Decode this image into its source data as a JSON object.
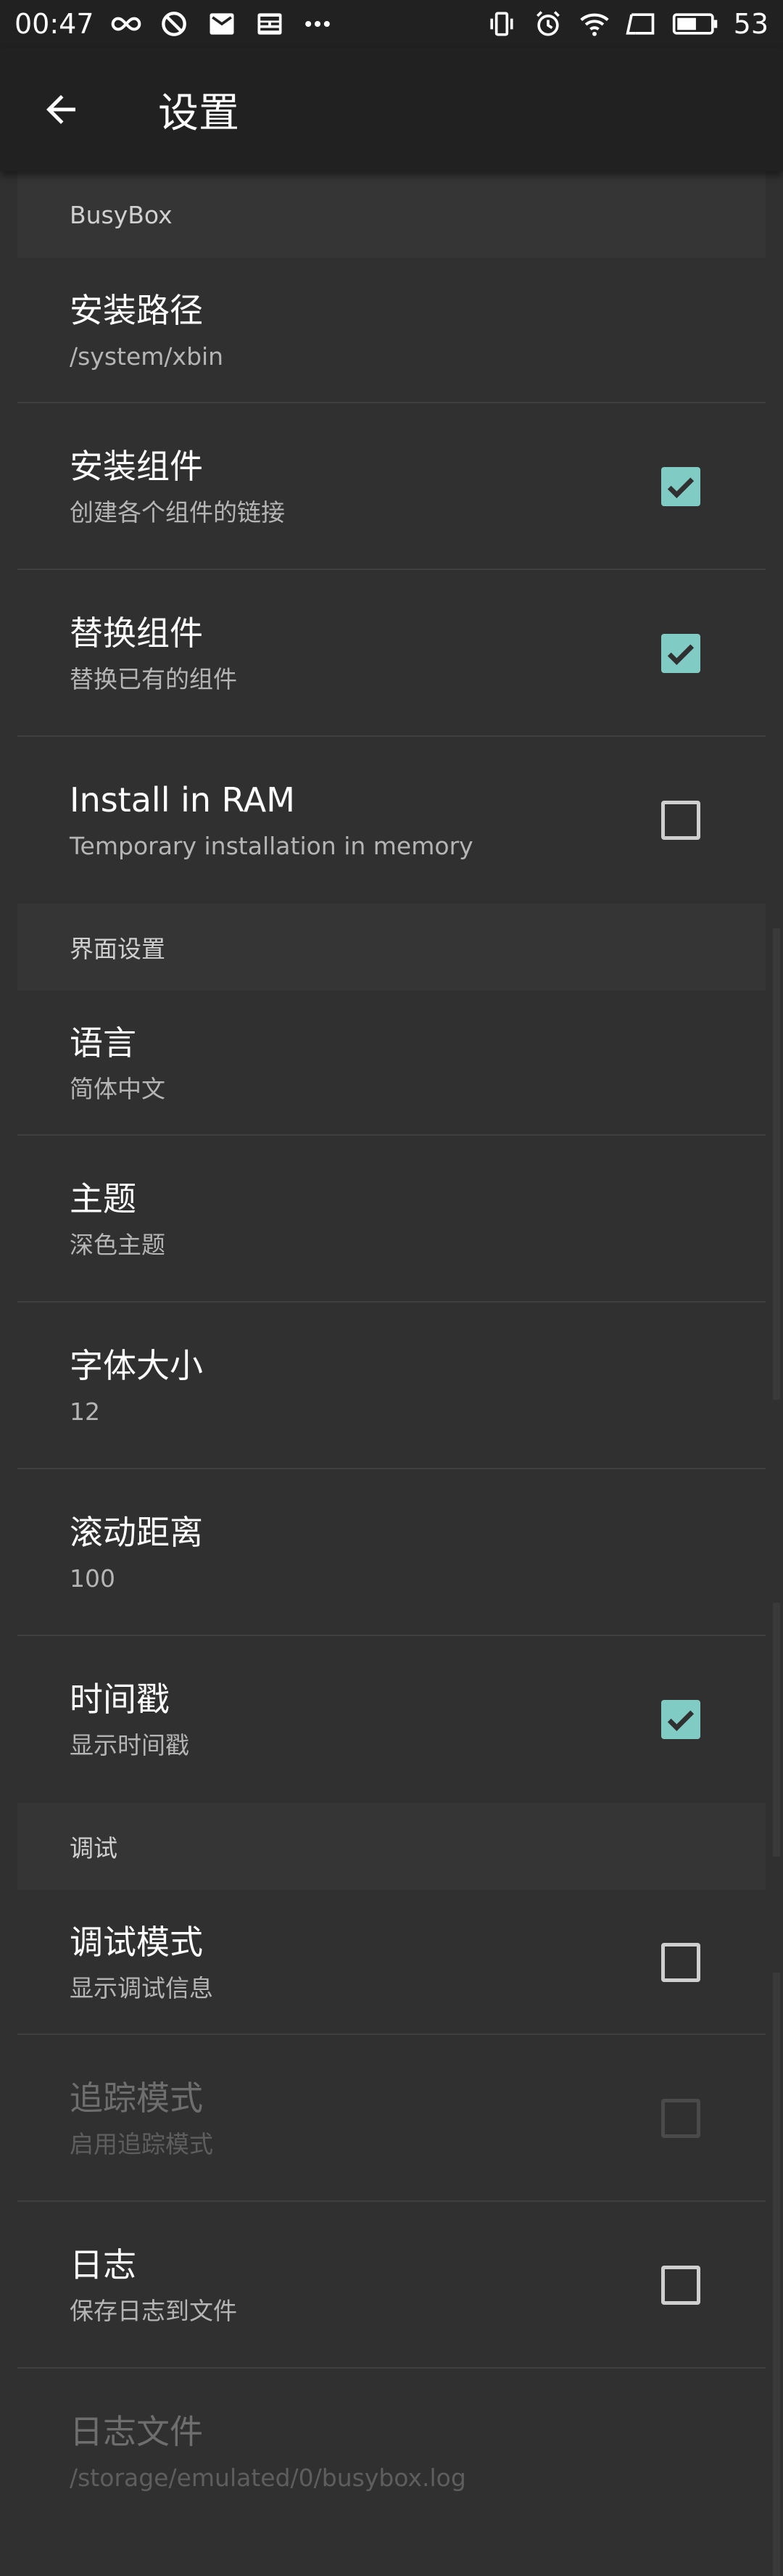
{
  "status_bar": {
    "time": "00:47",
    "battery": "53",
    "left_icons": [
      "infinity-icon",
      "blocked-icon",
      "mail-icon",
      "news-icon",
      "more-dots-icon"
    ],
    "right_icons": [
      "vibrate-icon",
      "alarm-icon",
      "wifi-icon",
      "cast-icon",
      "battery-icon"
    ]
  },
  "app_bar": {
    "title": "设置"
  },
  "sections": [
    {
      "category": "BusyBox",
      "items": [
        {
          "title": "安装路径",
          "summary": "/system/xbin",
          "checkbox": null,
          "enabled": true
        },
        {
          "title": "安装组件",
          "summary": "创建各个组件的链接",
          "checkbox": true,
          "enabled": true
        },
        {
          "title": "替换组件",
          "summary": "替换已有的组件",
          "checkbox": true,
          "enabled": true
        },
        {
          "title": "Install in RAM",
          "summary": "Temporary installation in memory",
          "checkbox": false,
          "enabled": true
        }
      ]
    },
    {
      "category": "界面设置",
      "items": [
        {
          "title": "语言",
          "summary": "简体中文",
          "checkbox": null,
          "enabled": true
        },
        {
          "title": "主题",
          "summary": "深色主题",
          "checkbox": null,
          "enabled": true
        },
        {
          "title": "字体大小",
          "summary": "12",
          "checkbox": null,
          "enabled": true
        },
        {
          "title": "滚动距离",
          "summary": "100",
          "checkbox": null,
          "enabled": true
        },
        {
          "title": "时间戳",
          "summary": "显示时间戳",
          "checkbox": true,
          "enabled": true
        }
      ]
    },
    {
      "category": "调试",
      "items": [
        {
          "title": "调试模式",
          "summary": "显示调试信息",
          "checkbox": false,
          "enabled": true
        },
        {
          "title": "追踪模式",
          "summary": "启用追踪模式",
          "checkbox": false,
          "enabled": false
        },
        {
          "title": "日志",
          "summary": "保存日志到文件",
          "checkbox": false,
          "enabled": true
        },
        {
          "title": "日志文件",
          "summary": "/storage/emulated/0/busybox.log",
          "checkbox": null,
          "enabled": false
        }
      ]
    }
  ],
  "colors": {
    "accent": "#80cbc4",
    "background": "#303030",
    "toolbar": "#212121",
    "category_bg": "#353535"
  }
}
